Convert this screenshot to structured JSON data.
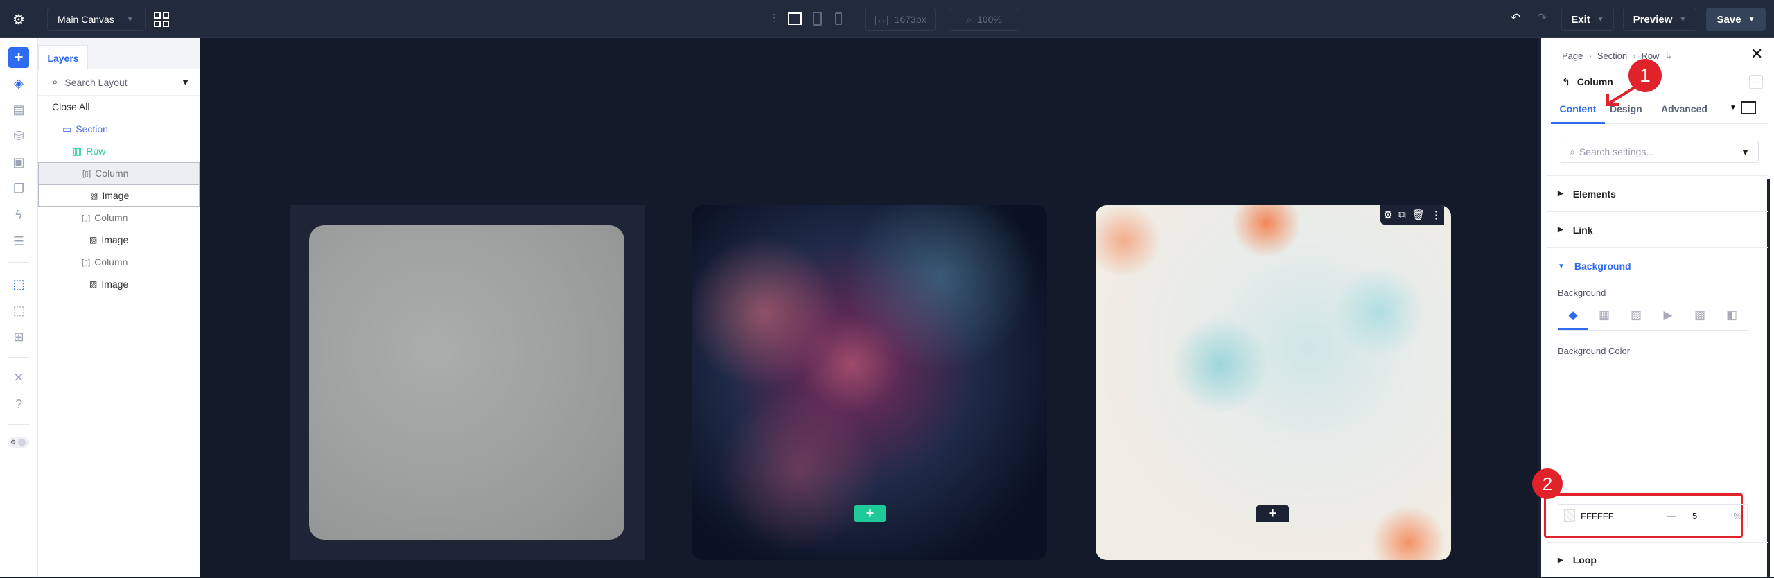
{
  "topbar": {
    "canvas_select": "Main Canvas",
    "width_value": "1673px",
    "zoom_value": "100%",
    "exit_label": "Exit",
    "preview_label": "Preview",
    "save_label": "Save"
  },
  "layers": {
    "tab_label": "Layers",
    "search_placeholder": "Search Layout",
    "close_all": "Close All",
    "items": [
      {
        "label": "Section"
      },
      {
        "label": "Row"
      },
      {
        "label": "Column"
      },
      {
        "label": "Image"
      },
      {
        "label": "Column"
      },
      {
        "label": "Image"
      },
      {
        "label": "Column"
      },
      {
        "label": "Image"
      }
    ]
  },
  "panel": {
    "breadcrumb": [
      "Page",
      "Section",
      "Row"
    ],
    "title": "Column",
    "tabs": [
      "Content",
      "Design",
      "Advanced"
    ],
    "search_placeholder": "Search settings...",
    "sections": {
      "elements": "Elements",
      "link": "Link",
      "background": "Background",
      "loop": "Loop"
    },
    "background_label": "Background",
    "background_color_label": "Background Color",
    "color_value": "FFFFFF",
    "opacity_value": "5",
    "opacity_unit": "%",
    "dash": "—"
  },
  "annotations": {
    "one": "1",
    "two": "2"
  },
  "colors": {
    "accent": "#2f6bf0",
    "green": "#1fc99a",
    "annotation_red": "#e0222b"
  }
}
